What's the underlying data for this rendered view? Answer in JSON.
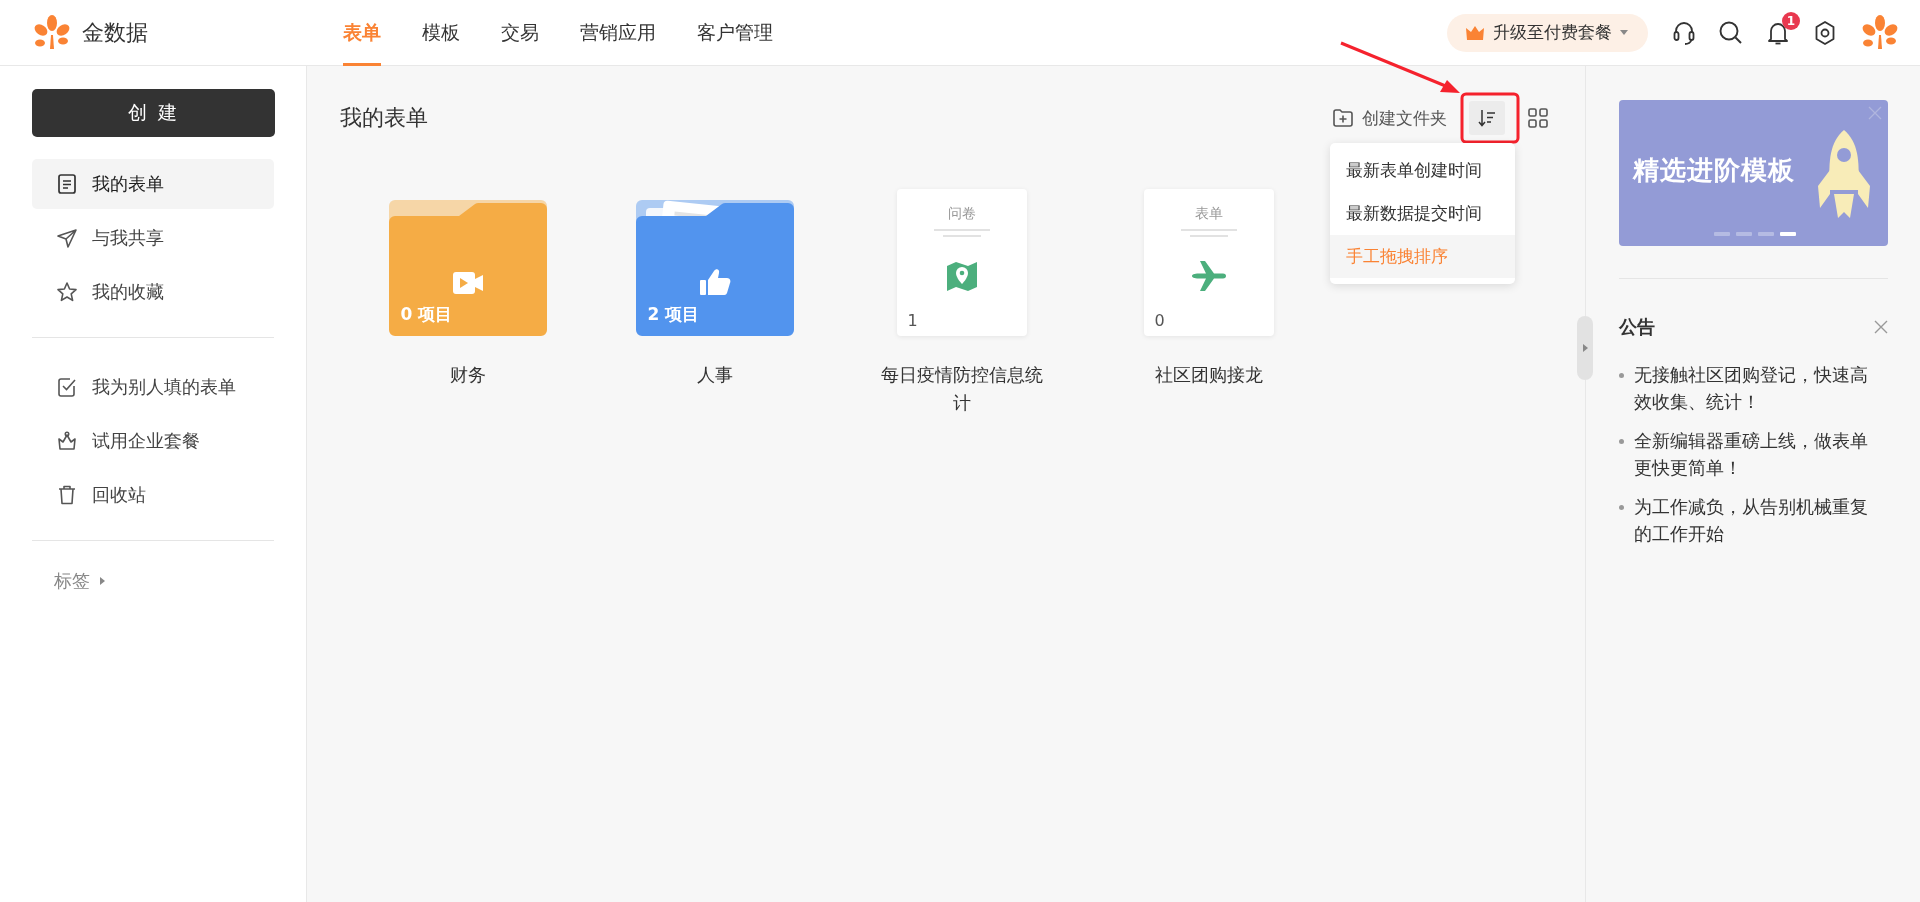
{
  "app": {
    "name": "金数据"
  },
  "nav": [
    {
      "label": "表单",
      "selected": true
    },
    {
      "label": "模板",
      "selected": false
    },
    {
      "label": "交易",
      "selected": false
    },
    {
      "label": "营销应用",
      "selected": false
    },
    {
      "label": "客户管理",
      "selected": false
    }
  ],
  "upgrade": {
    "label": "升级至付费套餐"
  },
  "notifications": {
    "badge": "1"
  },
  "sidebar": {
    "create_button": "创 建",
    "groups": [
      [
        {
          "label": "我的表单",
          "selected": true
        },
        {
          "label": "与我共享",
          "selected": false
        },
        {
          "label": "我的收藏",
          "selected": false
        }
      ],
      [
        {
          "label": "我为别人填的表单",
          "selected": false
        },
        {
          "label": "试用企业套餐",
          "selected": false
        },
        {
          "label": "回收站",
          "selected": false
        }
      ]
    ],
    "tags_label": "标签"
  },
  "main": {
    "title": "我的表单",
    "new_folder": "创建文件夹",
    "sort_menu": [
      {
        "label": "最新表单创建时间",
        "selected": false
      },
      {
        "label": "最新数据提交时间",
        "selected": false
      },
      {
        "label": "手工拖拽排序",
        "selected": true
      }
    ],
    "items": [
      {
        "kind": "folder",
        "color": "#f5ac45",
        "has_files": false,
        "count": "0 项目",
        "name": "财务"
      },
      {
        "kind": "folder",
        "color": "#5294ee",
        "has_files": true,
        "count": "2 项目",
        "name": "人事"
      },
      {
        "kind": "form",
        "type_label": "问卷",
        "count": "1",
        "name": "每日疫情防控信息统计"
      },
      {
        "kind": "form",
        "type_label": "表单",
        "count": "0",
        "name": "社区团购接龙"
      }
    ]
  },
  "banner": {
    "title": "精选进阶模板",
    "slides": [
      {
        "selected": false
      },
      {
        "selected": false
      },
      {
        "selected": false
      },
      {
        "selected": true
      }
    ]
  },
  "announcements": {
    "title": "公告",
    "items": [
      "无接触社区团购登记，快速高效收集、统计！",
      "全新编辑器重磅上线，做表单更快更简单！",
      "为工作减负，从告别机械重复的工作开始"
    ]
  }
}
